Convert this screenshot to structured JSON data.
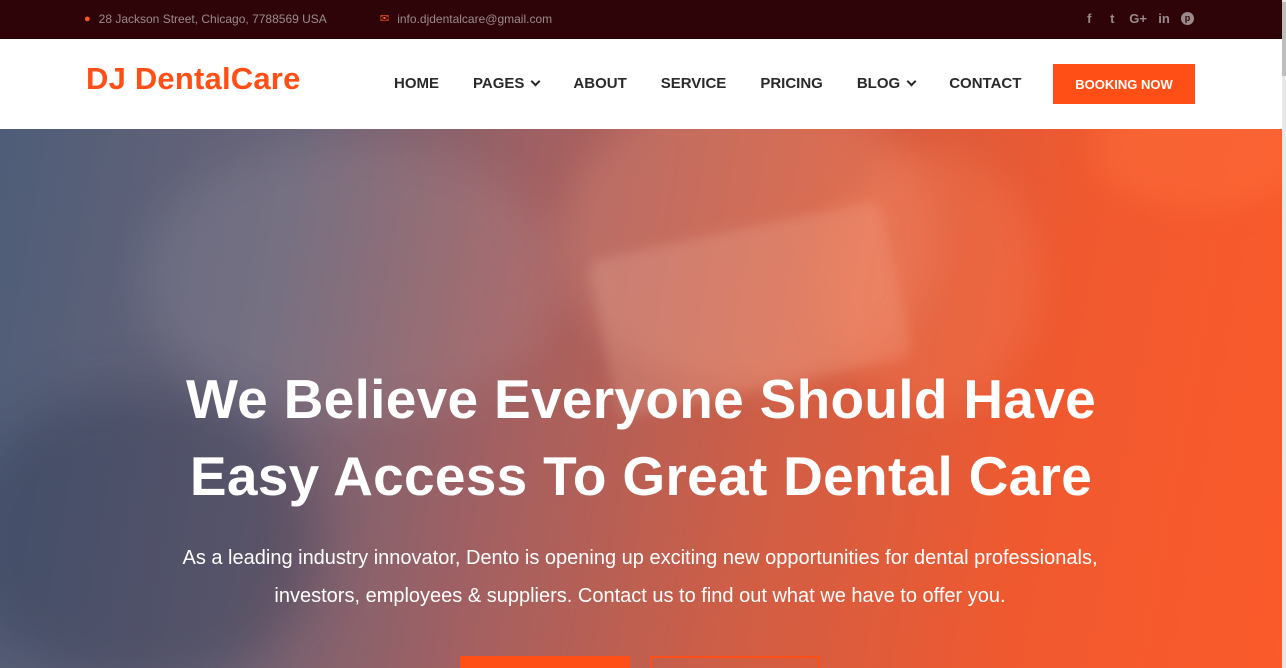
{
  "topbar": {
    "address": "28 Jackson Street, Chicago, 7788569 USA",
    "email": "info.djdentalcare@gmail.com",
    "socials": [
      {
        "icon": "facebook-icon",
        "glyph": "f"
      },
      {
        "icon": "twitter-icon",
        "glyph": "t"
      },
      {
        "icon": "google-plus-icon",
        "glyph": "G+"
      },
      {
        "icon": "linkedin-icon",
        "glyph": "in"
      },
      {
        "icon": "pinterest-icon",
        "glyph": "p"
      }
    ]
  },
  "header": {
    "logo": "DJ DentalCare",
    "nav": {
      "home": "HOME",
      "pages": "PAGES",
      "about": "ABOUT",
      "service": "SERVICE",
      "pricing": "PRICING",
      "blog": "BLOG",
      "contact": "CONTACT"
    },
    "booking_button": "BOOKING NOW"
  },
  "hero": {
    "title_line1": "We Believe Everyone Should Have",
    "title_line2": "Easy Access To Great Dental Care",
    "subtitle_line1": "As a leading industry innovator, Dento is opening up exciting new opportunities for dental professionals,",
    "subtitle_line2": "investors, employees & suppliers. Contact us to find out what we have to offer you."
  },
  "colors": {
    "accent": "#ff4f17",
    "topbar_bg": "#2f0409",
    "header_bg": "#ffffff"
  }
}
